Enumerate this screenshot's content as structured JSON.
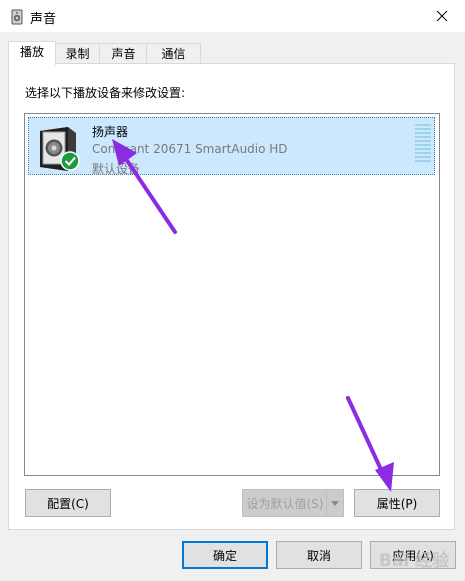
{
  "window": {
    "title": "声音",
    "icon": "speaker-app-icon"
  },
  "tabs": [
    {
      "label": "播放",
      "active": true
    },
    {
      "label": "录制",
      "active": false
    },
    {
      "label": "声音",
      "active": false
    },
    {
      "label": "通信",
      "active": false
    }
  ],
  "playback": {
    "instruction": "选择以下播放设备来修改设置:",
    "devices": [
      {
        "name": "扬声器",
        "description": "Conexant 20671 SmartAudio HD",
        "status": "默认设备",
        "icon": "speaker-device-icon",
        "badge": "default-check-icon",
        "selected": true,
        "level": 0
      }
    ]
  },
  "buttons": {
    "configure": "配置(C)",
    "set_default": "设为默认值(S)",
    "properties": "属性(P)",
    "ok": "确定",
    "cancel": "取消",
    "apply": "应用(A)"
  },
  "watermark": {
    "text": "Bai 经验"
  },
  "colors": {
    "selection": "#cce8ff",
    "accent": "#0078d7",
    "annotation_arrow": "#8b2be2",
    "check_badge": "#1e9b3c"
  }
}
